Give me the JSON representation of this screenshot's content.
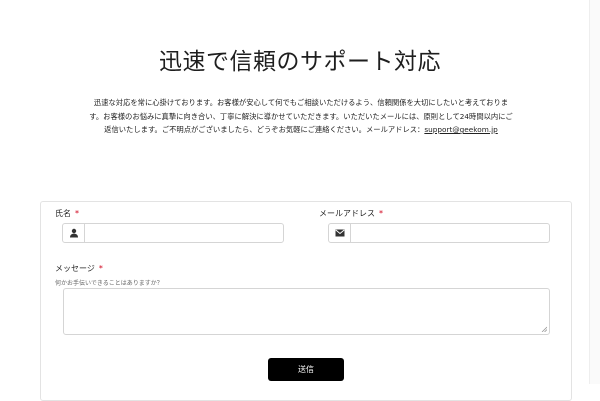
{
  "header": {
    "title": "迅速で信頼のサポート対応"
  },
  "intro": {
    "text": "迅速な対応を常に心掛けております。お客様が安心して何でもご相談いただけるよう、信頼関係を大切にしたいと考えております。お客様のお悩みに真摯に向き合い、丁寧に解決に導かせていただきます。いただいたメールには、原則として24時間以内にご返信いたします。ご不明点がございましたら、どうぞお気軽にご連絡ください。メールアドレス：",
    "email": "support@geekom.jp"
  },
  "form": {
    "name_label": "氏名",
    "email_label": "メールアドレス",
    "message_label": "メッセージ",
    "message_hint": "何かお手伝いできることはありますか？",
    "required_mark": "*",
    "name_value": "",
    "email_value": "",
    "message_value": "",
    "submit_label": "送信"
  },
  "icons": {
    "name_field": "user-icon",
    "email_field": "envelope-icon"
  }
}
